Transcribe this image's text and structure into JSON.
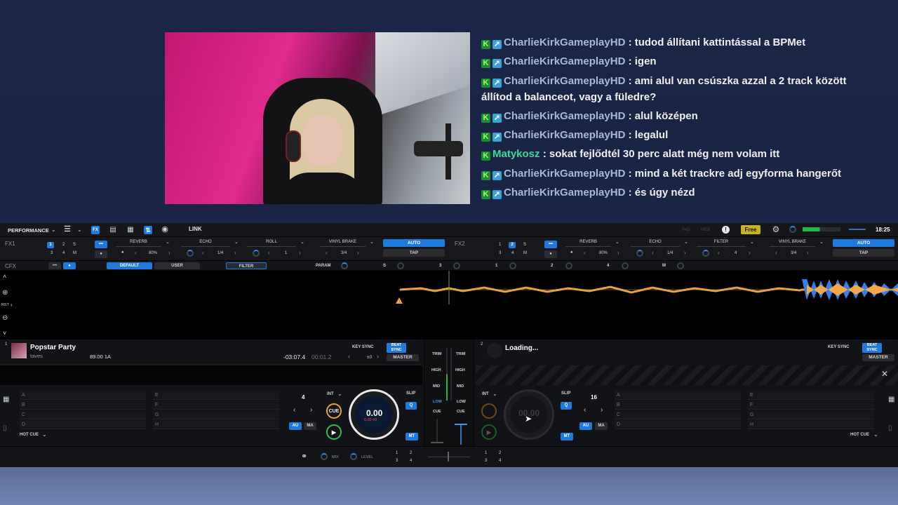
{
  "chat": [
    {
      "user": "CharlieKirkGameplayHD",
      "user_color": "blue",
      "message": " : tudod állítani kattintással a BPMet",
      "badges": [
        "k",
        "arrow"
      ]
    },
    {
      "user": "CharlieKirkGameplayHD",
      "user_color": "blue",
      "message": " : igen",
      "badges": [
        "k",
        "arrow"
      ]
    },
    {
      "user": "CharlieKirkGameplayHD",
      "user_color": "blue",
      "message": " : ami alul van csúszka azzal a 2 track között állítod a balanceot, vagy a füledre?",
      "badges": [
        "k",
        "arrow"
      ]
    },
    {
      "user": "CharlieKirkGameplayHD",
      "user_color": "blue",
      "message": " : alul középen",
      "badges": [
        "k",
        "arrow"
      ]
    },
    {
      "user": "CharlieKirkGameplayHD",
      "user_color": "blue",
      "message": " : legalul",
      "badges": [
        "k",
        "arrow"
      ]
    },
    {
      "user": "Matykosz",
      "user_color": "green",
      "message": " : sokat fejlődtél 30 perc alatt még nem volam itt",
      "badges": [
        "k"
      ]
    },
    {
      "user": "CharlieKirkGameplayHD",
      "user_color": "blue",
      "message": " : mind a két trackre adj egyforma hangerőt",
      "badges": [
        "k",
        "arrow"
      ]
    },
    {
      "user": "CharlieKirkGameplayHD",
      "user_color": "blue",
      "message": " : és úgy nézd",
      "badges": [
        "k",
        "arrow"
      ]
    }
  ],
  "topbar": {
    "mode": "PERFORMANCE",
    "link": "LINK",
    "pad": "PAD",
    "midi": "MIDI",
    "plan": "Free",
    "clock": "18:25"
  },
  "fx1": {
    "label": "FX1",
    "nums": [
      "1",
      "2",
      "S",
      "3",
      "4",
      "M"
    ],
    "more": "•••",
    "slots": [
      {
        "name": "REVERB",
        "val": "80%"
      },
      {
        "name": "ECHO",
        "val": "1/4"
      },
      {
        "name": "ROLL",
        "val": "1"
      }
    ],
    "vinyl": {
      "name": "VINYL BRAKE",
      "val": "3/4"
    },
    "auto": "AUTO",
    "tap": "TAP"
  },
  "fx2": {
    "label": "FX2",
    "nums": [
      "1",
      "2",
      "S",
      "3",
      "4",
      "M"
    ],
    "more": "•••",
    "slots": [
      {
        "name": "REVERB",
        "val": "80%"
      },
      {
        "name": "ECHO",
        "val": "1/4"
      },
      {
        "name": "FILTER",
        "val": "4"
      }
    ],
    "vinyl": {
      "name": "VINYL BRAKE",
      "val": "3/4"
    },
    "auto": "AUTO",
    "tap": "TAP"
  },
  "cfx": {
    "label": "CFX",
    "more": "•••",
    "default": "DEFAULT",
    "user": "USER",
    "filter": "FILTER",
    "param": "PARAM",
    "s": "S",
    "three": "3",
    "one": "1",
    "two": "2",
    "four": "4",
    "m": "M"
  },
  "wave_tools": {
    "rst": "RST"
  },
  "deck1": {
    "num": "1",
    "title": "Popstar Party",
    "artist": "taves",
    "bpm_key": "89.00 1A",
    "remain": "-03:07.4",
    "elapsed": "00:01.2",
    "key_sync": "KEY SYNC",
    "beat_sync": "BEAT SYNC",
    "pitch": "±0",
    "master": "MASTER",
    "hotcues_left": [
      "A",
      "B",
      "C",
      "D"
    ],
    "hotcues_right": [
      "E",
      "F",
      "G",
      "H"
    ],
    "hot_cue": "HOT CUE",
    "loop": "4",
    "int": "INT",
    "cue": "CUE",
    "au": "AU",
    "ma": "MA",
    "jog_main": "0.00",
    "jog_sub": "0.00 ±0",
    "slip": "SLIP",
    "q": "Q",
    "mt": "MT"
  },
  "deck2": {
    "num": "2",
    "loading": "Loading...",
    "key_sync": "KEY SYNC",
    "beat_sync": "BEAT SYNC",
    "master": "MASTER",
    "hotcues_left": [
      "A",
      "B",
      "C",
      "D"
    ],
    "hotcues_right": [
      "E",
      "F",
      "G",
      "H"
    ],
    "hot_cue": "HOT CUE",
    "loop": "16",
    "int": "INT",
    "au": "AU",
    "ma": "MA",
    "jog_main": "00.00",
    "slip": "SLIP",
    "q": "Q",
    "mt": "MT"
  },
  "mixer": {
    "trim": "TRIM",
    "high": "HIGH",
    "mid": "MID",
    "low": "LOW",
    "cue": "CUE"
  },
  "bottom": {
    "mix": "MIX",
    "level": "LEVEL",
    "nums": [
      "1",
      "2",
      "3",
      "4"
    ]
  }
}
